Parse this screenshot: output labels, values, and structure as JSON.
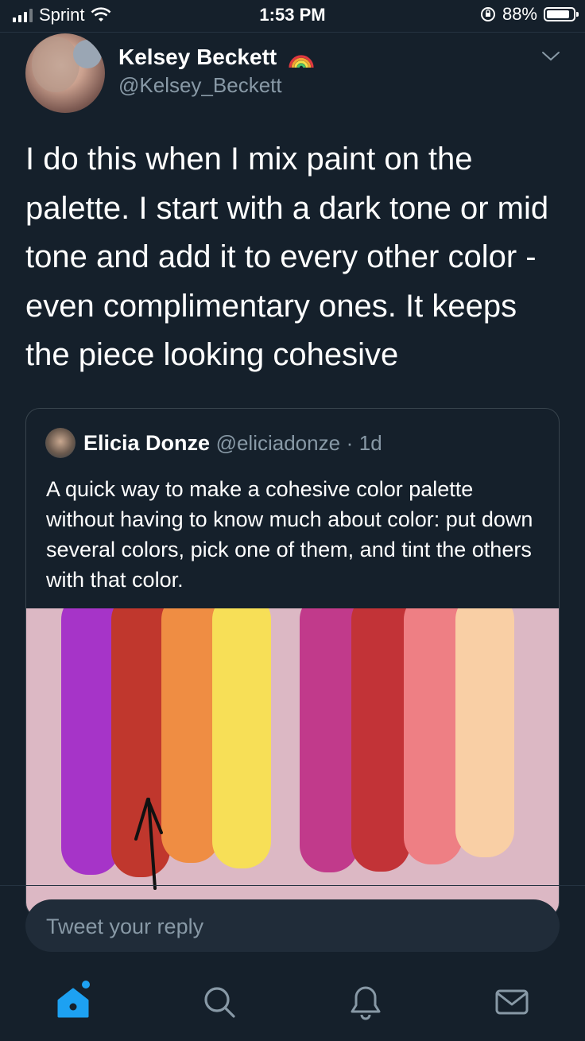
{
  "status_bar": {
    "carrier": "Sprint",
    "time": "1:53 PM",
    "battery_percent": "88%",
    "battery_level": 0.88,
    "icons": [
      "signal-icon",
      "wifi-icon",
      "orientation-lock-icon",
      "battery-icon"
    ]
  },
  "tweet": {
    "author_name": "Kelsey Beckett",
    "author_handle": "@Kelsey_Beckett",
    "name_emoji": "rainbow-icon",
    "text": "I do this when I mix paint on the palette. I start with a dark tone or mid tone and add it to every other color - even complimentary ones. It keeps the piece looking cohesive"
  },
  "quoted_tweet": {
    "author_name": "Elicia Donze",
    "author_handle": "@eliciadonze",
    "separator": "·",
    "time": "1d",
    "text": "A quick way to make a cohesive color palette without having to know much about color: put down several colors, pick one of them, and tint the others with that color.",
    "image_background": "#dcb8c4",
    "swatch_colors": [
      "#a634c8",
      "#c0372d",
      "#ef8d43",
      "#f7df57",
      "#c13a8b",
      "#c23337",
      "#ee7f84",
      "#f9cfa5"
    ]
  },
  "reply": {
    "placeholder": "Tweet your reply"
  },
  "tab_bar": {
    "tabs": [
      "home-icon",
      "search-icon",
      "notifications-icon",
      "messages-icon"
    ],
    "accent_color": "#1da1f2"
  }
}
